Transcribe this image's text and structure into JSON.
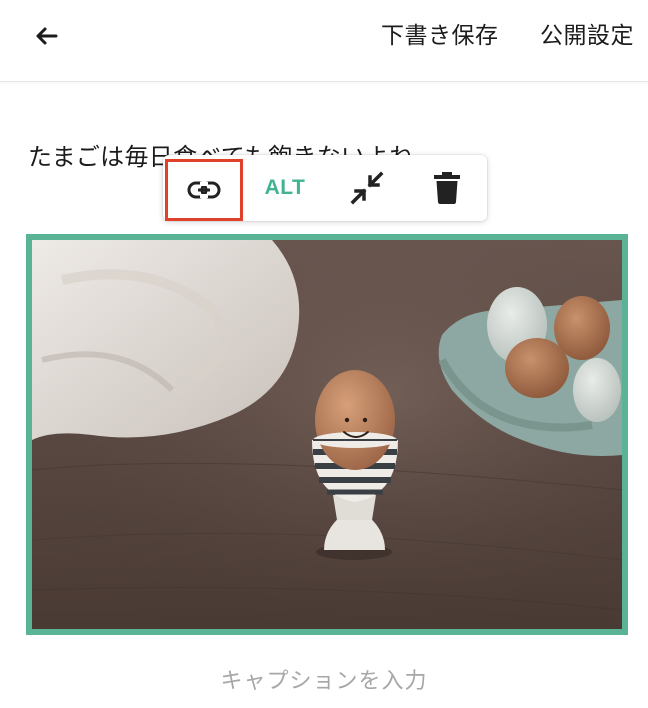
{
  "header": {
    "back_icon": "arrow-left-icon",
    "save_draft_label": "下書き保存",
    "publish_settings_label": "公開設定"
  },
  "editor": {
    "paragraph_text": "たまごは毎日食べても飽きないよね",
    "image_toolbar": {
      "link_icon": "link-icon",
      "alt_label": "ALT",
      "shrink_icon": "collapse-arrows-icon",
      "delete_icon": "trash-icon",
      "highlight_color": "#e0412b"
    },
    "image": {
      "frame_color": "#5ab394",
      "subject": "egg-in-egg-cup-photo"
    },
    "caption_placeholder": "キャプションを入力"
  },
  "colors": {
    "accent": "#41b393",
    "placeholder": "#a7a7a7"
  }
}
